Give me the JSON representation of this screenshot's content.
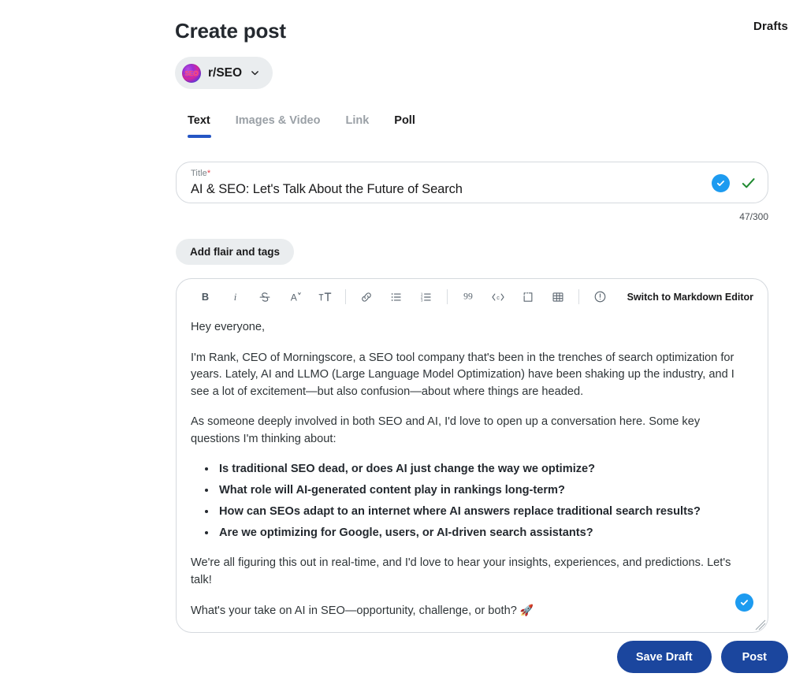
{
  "header": {
    "title": "Create post",
    "drafts_label": "Drafts"
  },
  "community": {
    "name": "r/SEO",
    "avatar_text": "SEO",
    "chevron_icon": "chevron-down-icon"
  },
  "tabs": [
    {
      "label": "Text",
      "active": true,
      "muted": false
    },
    {
      "label": "Images & Video",
      "active": false,
      "muted": true
    },
    {
      "label": "Link",
      "active": false,
      "muted": true
    },
    {
      "label": "Poll",
      "active": false,
      "muted": false
    }
  ],
  "title_field": {
    "label": "Title",
    "required_marker": "*",
    "value": "AI & SEO: Let's Talk About the Future of Search",
    "placeholder": "Title",
    "counter": "47/300",
    "grammar_badge_icon": "blue-check-badge-icon",
    "valid_icon": "green-check-icon"
  },
  "flair": {
    "label": "Add flair and tags"
  },
  "editor": {
    "markdown_switch_label": "Switch to Markdown Editor",
    "toolbar": [
      {
        "name": "bold-icon",
        "label": "B"
      },
      {
        "name": "italic-icon",
        "label": "i"
      },
      {
        "name": "strikethrough-icon",
        "label": "S"
      },
      {
        "name": "superscript-icon",
        "label": "A"
      },
      {
        "name": "heading-icon",
        "label": "T"
      },
      {
        "name": "separator",
        "label": ""
      },
      {
        "name": "link-icon",
        "label": ""
      },
      {
        "name": "bulleted-list-icon",
        "label": ""
      },
      {
        "name": "numbered-list-icon",
        "label": ""
      },
      {
        "name": "separator",
        "label": ""
      },
      {
        "name": "quote-icon",
        "label": "99"
      },
      {
        "name": "inline-code-icon",
        "label": "<c>"
      },
      {
        "name": "spoiler-icon",
        "label": ""
      },
      {
        "name": "table-icon",
        "label": ""
      },
      {
        "name": "separator",
        "label": ""
      },
      {
        "name": "alert-icon",
        "label": ""
      }
    ],
    "body": {
      "greeting": "Hey everyone,",
      "intro": "I'm Rank, CEO of Morningscore, a SEO tool company that's been in the trenches of search optimization for years. Lately, AI and LLMO (Large Language Model Optimization) have been shaking up the industry, and I see a lot of excitement—but also confusion—about where things are headed.",
      "lead_in": "As someone deeply involved in both SEO and AI, I'd love to open up a conversation here. Some key questions I'm thinking about:",
      "bullets": [
        "Is traditional SEO dead, or does AI just change the way we optimize?",
        "What role will AI-generated content play in rankings long-term?",
        "How can SEOs adapt to an internet where AI answers replace traditional search results?",
        "Are we optimizing for Google, users, or AI-driven search assistants?"
      ],
      "closing": "We're all figuring this out in real-time, and I'd love to hear your insights, experiences, and predictions. Let's talk!",
      "question": "What's your take on AI in SEO—opportunity, challenge, or both? ",
      "question_emoji": "🚀"
    },
    "grammar_badge_icon": "blue-check-badge-icon",
    "resize_handle_icon": "resize-handle-icon"
  },
  "footer": {
    "save_draft_label": "Save Draft",
    "post_label": "Post"
  },
  "colors": {
    "accent_blue": "#2556c4",
    "button_blue": "#1b469e",
    "badge_blue": "#1d9bf0",
    "green_check": "#1f8a30",
    "required_red": "#e8414a",
    "pill_grey": "#eaedef",
    "muted_text": "#9aa0a6"
  }
}
